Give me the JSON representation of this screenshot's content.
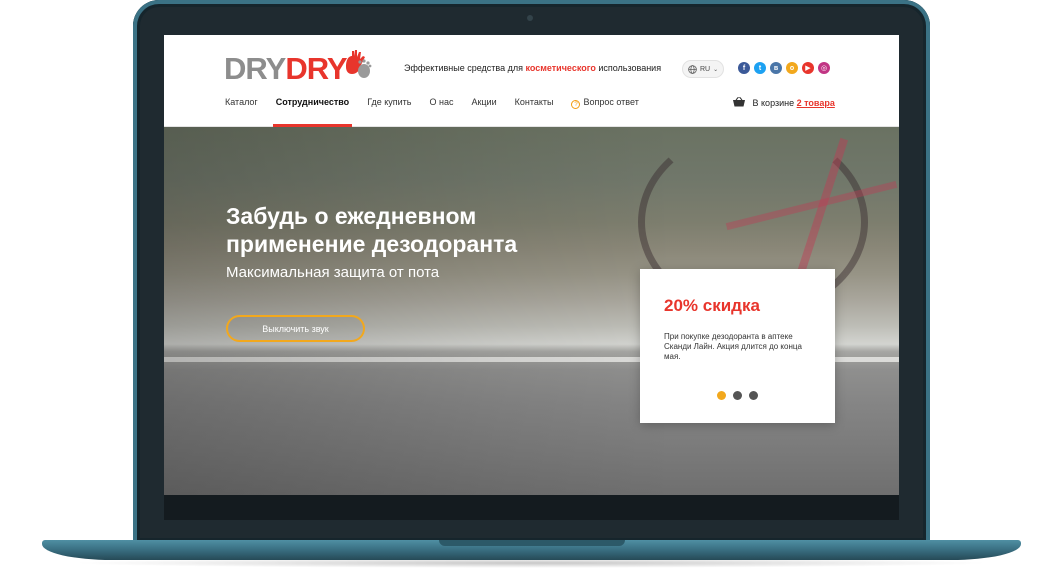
{
  "brand": {
    "logo_part1": "DRY",
    "logo_part2": "DRY",
    "tagline_pre": "Эффективные средства для ",
    "tagline_accent": "косметического",
    "tagline_post": " использования",
    "accent_color": "#e8352c",
    "highlight_color": "#f2a81d"
  },
  "language": {
    "selected": "RU"
  },
  "socials": [
    {
      "name": "facebook-icon",
      "glyph": "f",
      "color": "#3b5998"
    },
    {
      "name": "twitter-icon",
      "glyph": "t",
      "color": "#1da1f2"
    },
    {
      "name": "vk-icon",
      "glyph": "в",
      "color": "#4a76a8"
    },
    {
      "name": "odnoklassniki-icon",
      "glyph": "о",
      "color": "#f2a81d"
    },
    {
      "name": "youtube-icon",
      "glyph": "▶",
      "color": "#e8352c"
    },
    {
      "name": "instagram-icon",
      "glyph": "◎",
      "color": "#c13584"
    }
  ],
  "nav": {
    "items": [
      "Каталог",
      "Сотрудничество",
      "Где купить",
      "О нас",
      "Акции",
      "Контакты",
      "Вопрос ответ"
    ],
    "active_index": 1
  },
  "cart": {
    "label": "В корзине ",
    "count": "2 товара"
  },
  "hero": {
    "title": "Забудь о ежедневном применение дезодоранта",
    "subtitle": "Максимальная защита от пота",
    "button_label": "Выключить звук"
  },
  "promo": {
    "title": "20% скидка",
    "text": "При покупке дезодоранта в аптеке Сканди Лайн. Акция длится до конца мая.",
    "slides_total": 3,
    "slide_active": 1
  }
}
